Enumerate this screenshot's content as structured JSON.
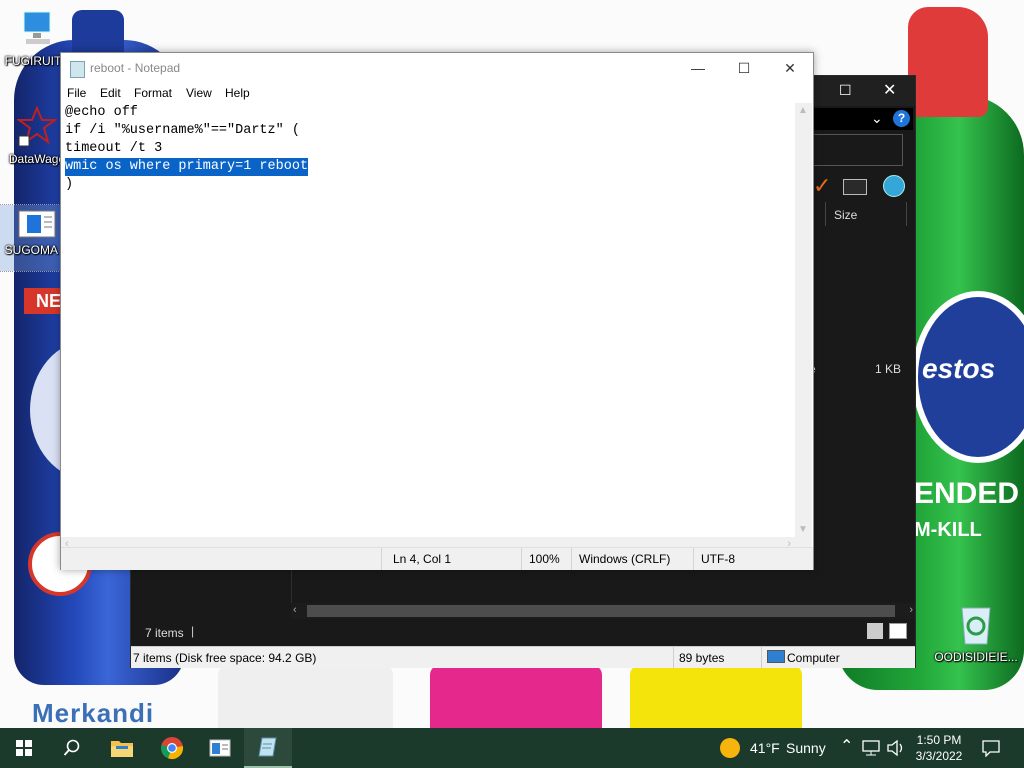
{
  "desktop": {
    "icons": [
      {
        "label": "FUGIRUITY"
      },
      {
        "label": "DataWago"
      },
      {
        "label": "SUGOMA D"
      },
      {
        "label": "OODISIDIEIE..."
      }
    ],
    "wallpaper": {
      "brand_text": "Merkandi",
      "blue_bottle_text": "NEW",
      "green_bottle_oval_text": "estos",
      "green_bottle_line1": "ENDED",
      "green_bottle_line2": "M-KILL"
    }
  },
  "notepad": {
    "title": "reboot - Notepad",
    "menu": [
      "File",
      "Edit",
      "Format",
      "View",
      "Help"
    ],
    "lines": [
      "@echo off",
      "if /i \"%username%\"==\"Dartz\" (",
      "timeout /t 3",
      "wmic os where primary=1 reboot",
      ")"
    ],
    "selected_line_index": 3,
    "status": {
      "position": "Ln 4, Col 1",
      "zoom": "100%",
      "line_ending": "Windows (CRLF)",
      "encoding": "UTF-8"
    },
    "window_buttons": {
      "minimize": "—",
      "maximize": "☐",
      "close": "✕"
    }
  },
  "explorer": {
    "column_size": "Size",
    "file_size": "1 KB",
    "file_partial_name": "e",
    "status_items": "7 items",
    "details_bar": {
      "items": "7 items (Disk free space: 94.2 GB)",
      "bytes": "89 bytes",
      "location": "Computer"
    }
  },
  "taskbar": {
    "weather": {
      "temp": "41°F",
      "condition": "Sunny"
    },
    "clock": {
      "time": "1:50 PM",
      "date": "3/3/2022"
    },
    "apps": [
      "start-button",
      "search-icon",
      "file-explorer-icon",
      "chrome-icon",
      "task-view-icon",
      "notepad-icon"
    ]
  },
  "colors": {
    "taskbar": "#1b3a2c",
    "selection": "#0a64c8",
    "explorer_bg": "#191919"
  }
}
